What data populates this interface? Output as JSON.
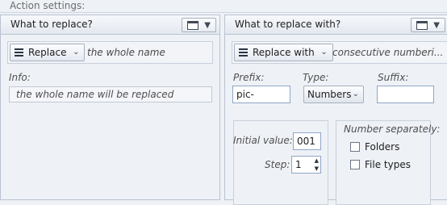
{
  "header": {
    "title": "Action settings:"
  },
  "left": {
    "title": "What to replace?",
    "dropdown_label": "Replace",
    "dropdown_value": "the whole name",
    "info_label": "Info:",
    "info_text": "the whole name will be replaced"
  },
  "right": {
    "title": "What to replace with?",
    "dropdown_label": "Replace with",
    "dropdown_value": "consecutive numberi...",
    "prefix_label": "Prefix:",
    "prefix_value": "pic-",
    "type_label": "Type:",
    "type_value": "Numbers",
    "suffix_label": "Suffix:",
    "suffix_value": "",
    "initial_label": "Initial value:",
    "initial_value": "001",
    "step_label": "Step:",
    "step_value": "1",
    "separately_label": "Number separately:",
    "folders_label": "Folders",
    "folders_checked": false,
    "filetypes_label": "File types",
    "filetypes_checked": false
  }
}
